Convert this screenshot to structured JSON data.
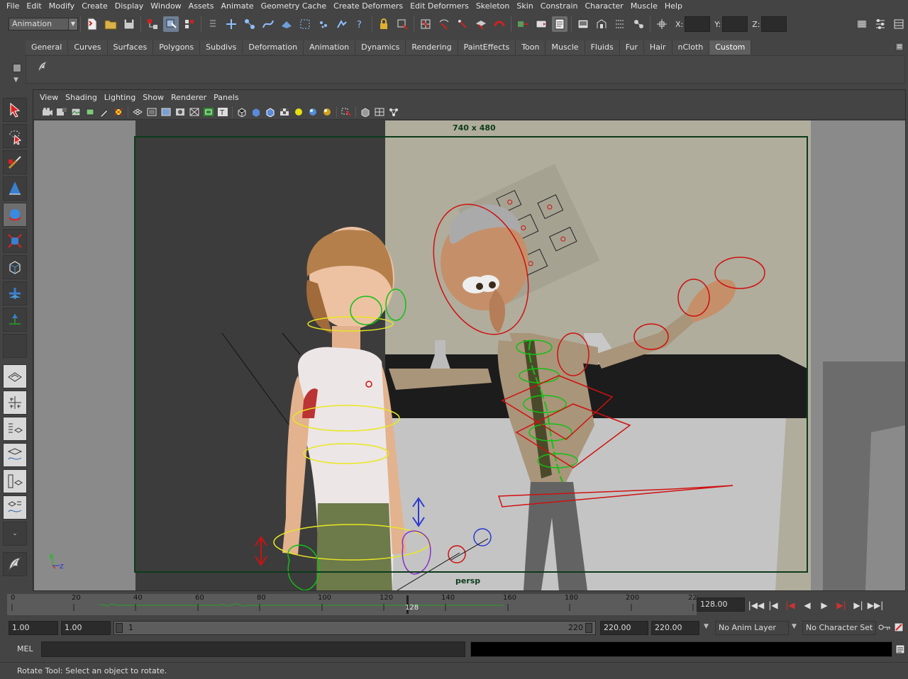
{
  "menubar": {
    "items": [
      "File",
      "Edit",
      "Modify",
      "Create",
      "Display",
      "Window",
      "Assets",
      "Animate",
      "Geometry Cache",
      "Create Deformers",
      "Edit Deformers",
      "Skeleton",
      "Skin",
      "Constrain",
      "Character",
      "Muscle",
      "Help"
    ]
  },
  "statusline": {
    "mode": "Animation",
    "x_label": "X:",
    "y_label": "Y:",
    "z_label": "Z:"
  },
  "shelf": {
    "tabs": [
      "General",
      "Curves",
      "Surfaces",
      "Polygons",
      "Subdivs",
      "Deformation",
      "Animation",
      "Dynamics",
      "Rendering",
      "PaintEffects",
      "Toon",
      "Muscle",
      "Fluids",
      "Fur",
      "Hair",
      "nCloth",
      "Custom"
    ],
    "active_tab": "Custom"
  },
  "panel": {
    "menu": [
      "View",
      "Shading",
      "Lighting",
      "Show",
      "Renderer",
      "Panels"
    ],
    "resolution_label": "740 x 480",
    "camera_label": "persp",
    "axis": {
      "y": "y",
      "z": "z"
    }
  },
  "timeslider": {
    "ticks": [
      "0",
      "20",
      "40",
      "60",
      "80",
      "100",
      "120",
      "140",
      "160",
      "180",
      "200",
      "22"
    ],
    "current_frame_marker": "128",
    "current_frame": "128.00"
  },
  "range": {
    "start_time": "1.00",
    "playback_start": "1.00",
    "range_start_label": "1",
    "range_end_label": "220",
    "playback_end": "220.00",
    "end_time": "220.00",
    "anim_layer": "No Anim Layer",
    "character_set": "No Character Set"
  },
  "cmdline": {
    "label": "MEL"
  },
  "helpline": {
    "text": "Rotate Tool: Select an object to rotate."
  },
  "colors": {
    "ui_bg": "#444444",
    "resolution_gate": "#0c3b1b",
    "control_red": "#d01010",
    "control_green": "#12c112",
    "control_yellow": "#e8e820",
    "control_blue": "#2a3ad0"
  }
}
